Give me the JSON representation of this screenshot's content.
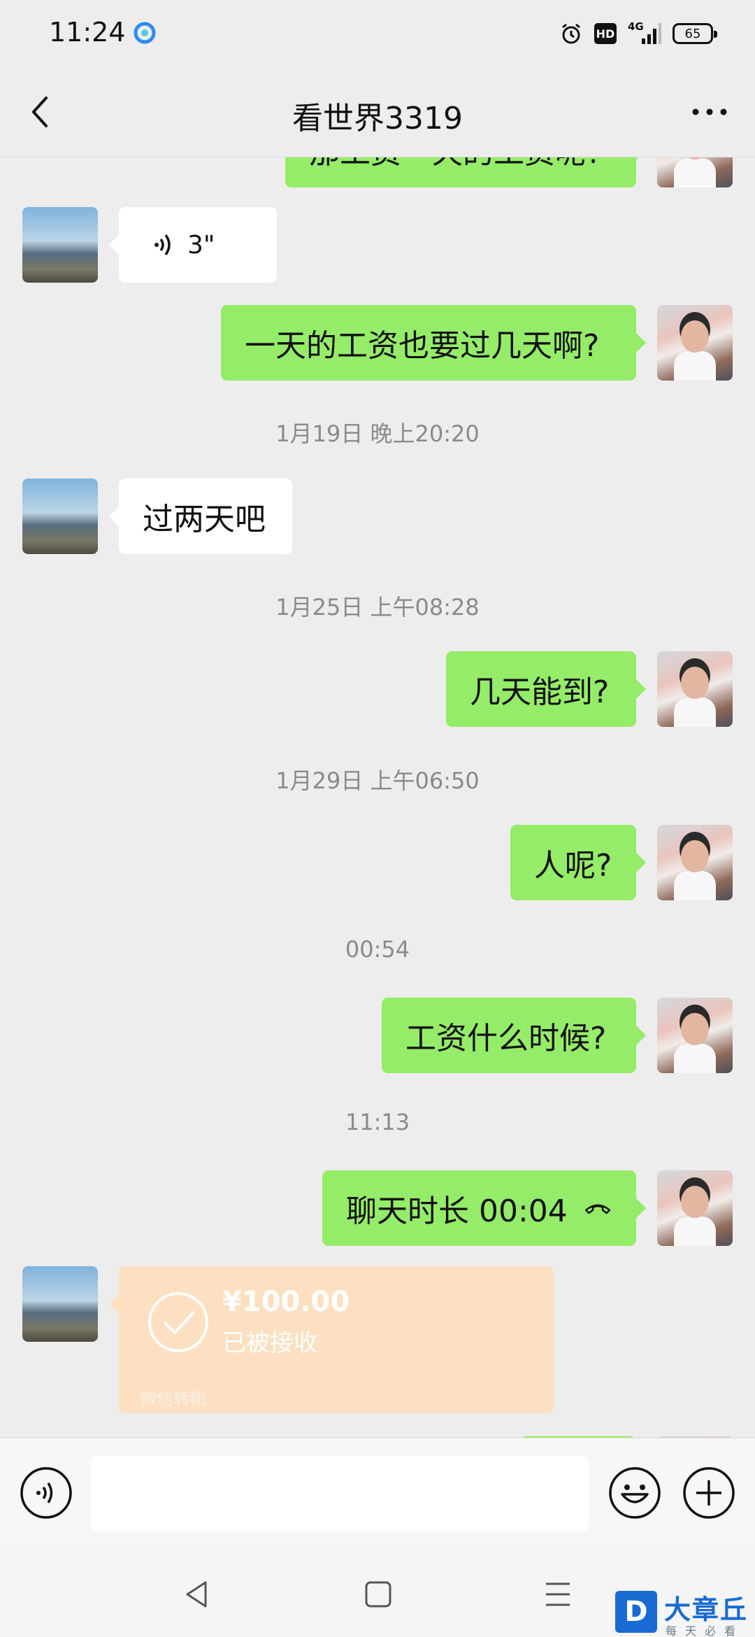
{
  "status_bar": {
    "time": "11:24",
    "network": "4G",
    "hd": "HD",
    "battery": "65",
    "icons": [
      "app-notification-icon",
      "alarm-icon",
      "hd-icon",
      "signal-icon",
      "battery-icon"
    ]
  },
  "header": {
    "title": "看世界3319",
    "back_icon": "back-arrow-icon",
    "more_icon": "more-icon"
  },
  "messages": [
    {
      "side": "right",
      "type": "text",
      "text": "那工资一天的工资呢?",
      "partial": true
    },
    {
      "side": "left",
      "type": "voice",
      "duration": "3\""
    },
    {
      "side": "right",
      "type": "text",
      "text": "一天的工资也要过几天啊?"
    },
    {
      "type": "timestamp",
      "text": "1月19日 晚上20:20"
    },
    {
      "side": "left",
      "type": "text",
      "text": "过两天吧"
    },
    {
      "type": "timestamp",
      "text": "1月25日 上午08:28"
    },
    {
      "side": "right",
      "type": "text",
      "text": "几天能到?"
    },
    {
      "type": "timestamp",
      "text": "1月29日 上午06:50"
    },
    {
      "side": "right",
      "type": "text",
      "text": "人呢?"
    },
    {
      "type": "timestamp",
      "text": "00:54"
    },
    {
      "side": "right",
      "type": "text",
      "text": "工资什么时候?"
    },
    {
      "type": "timestamp",
      "text": "11:13"
    },
    {
      "side": "right",
      "type": "call",
      "text": "聊天时长 00:04"
    },
    {
      "side": "left",
      "type": "transfer",
      "amount": "¥100.00",
      "status": "已被接收",
      "footer": "微信转账"
    }
  ],
  "input_bar": {
    "voice_icon": "voice-input-icon",
    "emoji_icon": "emoji-icon",
    "plus_icon": "plus-icon",
    "text": ""
  },
  "system_nav": {
    "icons": [
      "nav-back-icon",
      "nav-home-icon",
      "nav-menu-icon"
    ]
  },
  "watermark": {
    "logo_letter": "D",
    "name": "大章丘",
    "slogan": "每天必看"
  },
  "colors": {
    "chat_bg": "#ededed",
    "bubble_out": "#95ec69",
    "bubble_in": "#ffffff",
    "transfer_bg": "#fce0c1",
    "timestamp": "#8a8a8a",
    "watermark": "#1a6bd1"
  }
}
